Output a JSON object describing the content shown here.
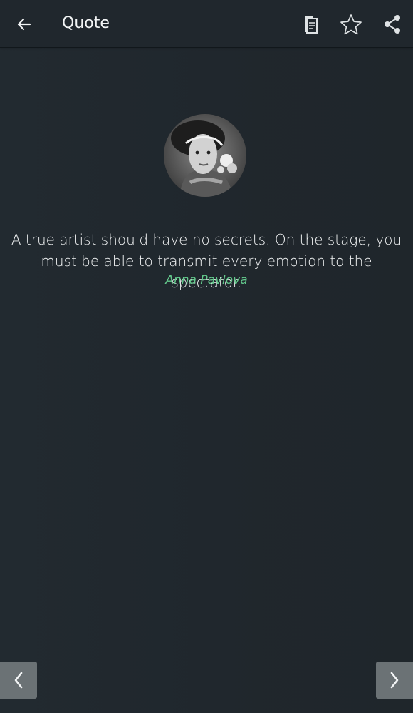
{
  "header": {
    "title": "Quote",
    "icons": {
      "back": "arrow-left-icon",
      "copy": "copy-icon",
      "favorite": "star-outline-icon",
      "share": "share-icon"
    }
  },
  "quote": {
    "text": "A true artist should have no secrets. On the stage, you must be able to transmit every emotion to the spectator.",
    "author": "Anna Pavlova",
    "author_color": "#63c98c"
  },
  "navigation": {
    "previous_icon": "chevron-left-icon",
    "next_icon": "chevron-right-icon"
  },
  "colors": {
    "background": "#1f262c",
    "toolbar": "#20272d",
    "nav_button": "#6b7275"
  }
}
